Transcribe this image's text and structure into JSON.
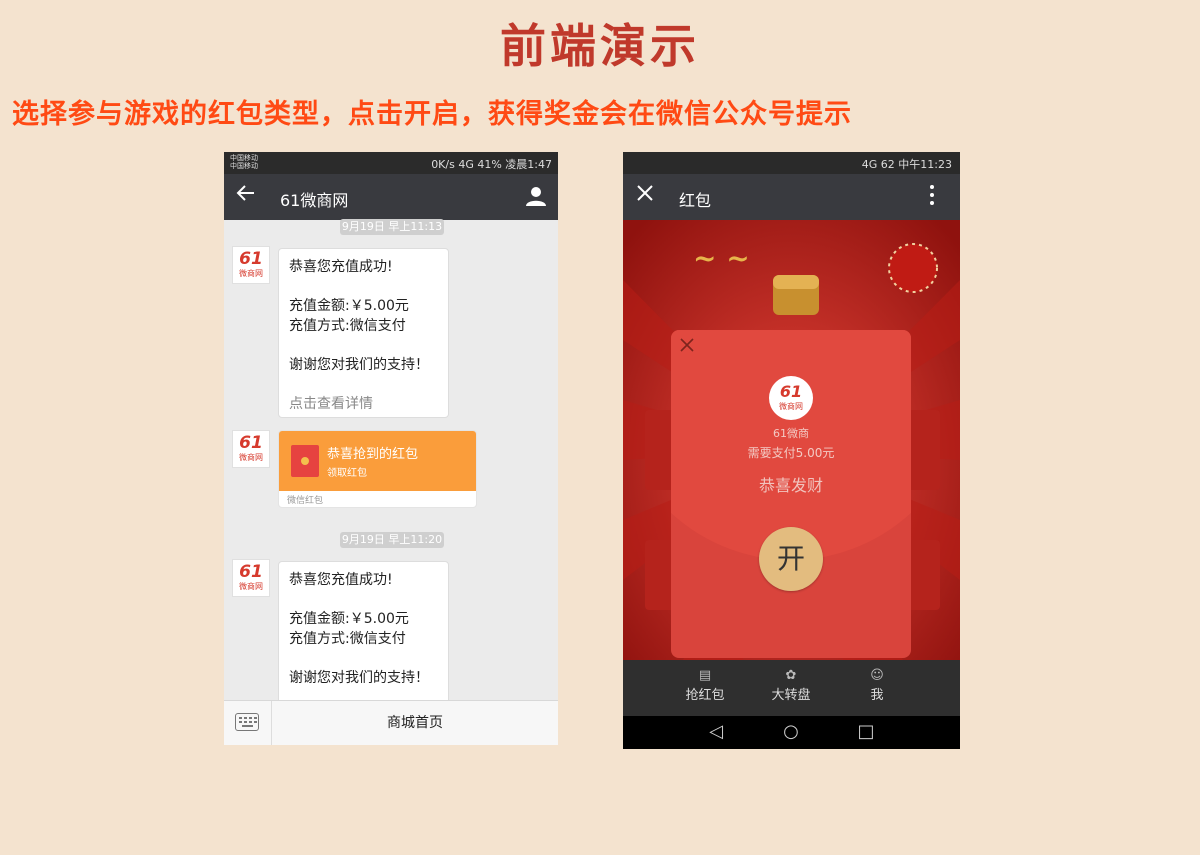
{
  "page": {
    "title": "前端演示",
    "subtitle": "选择参与游戏的红包类型，点击开启，获得奖金会在微信公众号提示"
  },
  "phone1": {
    "status": {
      "carrier_line1": "中国移动",
      "carrier_line2": "中国移动",
      "right": "0K/s 4G 41% 凌晨1:47"
    },
    "header": {
      "title": "61微商网"
    },
    "messages": [
      {
        "time": "9月19日 早上11:13",
        "line1": "恭喜您充值成功!",
        "line2": "充值金额:￥5.00元",
        "line3": "充值方式:微信支付",
        "line4": "谢谢您对我们的支持！",
        "link": "点击查看详情"
      },
      {
        "redpacket_title": "恭喜抢到的红包",
        "redpacket_sub": "领取红包",
        "redpacket_footer": "微信红包"
      },
      {
        "time": "9月19日 早上11:20",
        "line1": "恭喜您充值成功!",
        "line2": "充值金额:￥5.00元",
        "line3": "充值方式:微信支付",
        "line4": "谢谢您对我们的支持！"
      }
    ],
    "avatar": {
      "num": "61",
      "sub": "微商网"
    },
    "bottom": {
      "menu_label": "商城首页"
    }
  },
  "phone2": {
    "status": {
      "right": "4G 62 中午11:23"
    },
    "header": {
      "title": "红包"
    },
    "modal": {
      "logo_num": "61",
      "logo_sub": "微商网",
      "name": "61微商",
      "pay": "需要支付5.00元",
      "wish": "恭喜发财",
      "open_label": "开"
    },
    "tabs": [
      {
        "label": "抢红包",
        "icon": "document-icon"
      },
      {
        "label": "大转盘",
        "icon": "wheel-icon"
      },
      {
        "label": "我",
        "icon": "person-icon"
      }
    ]
  },
  "colors": {
    "background": "#f4e3cf",
    "title": "#c0392b",
    "subtitle": "#ff4a14",
    "wechat_header": "#393a3f",
    "redpacket_orange": "#fa9d3b",
    "modal_red": "#d9443c",
    "open_gold": "#e3bc7f"
  }
}
